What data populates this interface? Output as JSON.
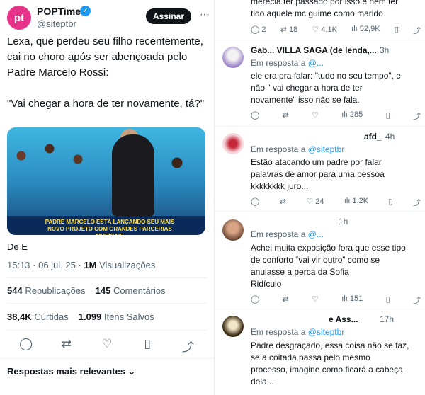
{
  "post": {
    "avatar_text": "pt",
    "name": "POPTime",
    "handle": "@siteptbr",
    "follow_label": "Assinar",
    "text": "Lexa, que perdeu seu filho recentemente, cai no choro após ser abençoada pelo Padre Marcelo Rossi:\n\n\"Vai chegar a hora de ter novamente, tá?\"",
    "media_ticker": "PADRE MARCELO ESTÁ LANÇANDO SEU MAIS NOVO PROJETO COM GRANDES PARCERIAS MUSICAIS",
    "from_label": "De E",
    "time": "15:13 · 06 jul. 25 · ",
    "views_count": "1M",
    "views_label": "Visualizações",
    "reposts_count": "544",
    "reposts_label": "Republicações",
    "comments_count": "145",
    "comments_label": "Comentários",
    "likes_count": "38,4K",
    "likes_label": "Curtidas",
    "saved_count": "1.099",
    "saved_label": "Itens Salvos",
    "relevant_label": "Respostas mais relevantes"
  },
  "replies": [
    {
      "text": "merecia ter passado por isso e nem ter\ntido aquele mc guime como marido",
      "replies": "2",
      "reposts": "18",
      "likes": "4,1K",
      "views": "52,9K"
    },
    {
      "name": "Gab... VILLA SAGA (de lenda,...",
      "time": "3h",
      "in_reply_label": "Em resposta a",
      "in_reply_handle": "@...",
      "text": "ele era pra falar: \"tudo no seu tempo\", e\nnão \" vai chegar a hora de ter\nnovamente\" isso não se fala.",
      "replies": "",
      "reposts": "",
      "likes": "",
      "views": "285"
    },
    {
      "name": "afd_",
      "time": "4h",
      "in_reply_label": "Em resposta a",
      "in_reply_handle": "@siteptbr",
      "text": "Estão atacando um padre por falar\npalavras de amor para uma pessoa\nkkkkkkkk juro...",
      "replies": "",
      "reposts": "",
      "likes": "24",
      "views": "1,2K"
    },
    {
      "name": "",
      "time": "1h",
      "in_reply_label": "Em resposta a",
      "in_reply_handle": "@...",
      "text": "Achei muita exposição fora que esse tipo\nde conforto “vai vir outro” como se\nanulasse a perca da Sofia\nRidículo",
      "replies": "",
      "reposts": "",
      "likes": "",
      "views": "151"
    },
    {
      "name": "e Ass...",
      "time": "17h",
      "in_reply_label": "Em resposta a",
      "in_reply_handle": "@siteptbr",
      "text": "Padre desgraçado, essa coisa não se faz,\nse a coitada passa pelo mesmo\nprocesso, imagine como ficará a cabeça\ndela..."
    }
  ],
  "icons": {
    "reply": "💬",
    "repost": "🔁",
    "like": "♡",
    "views": "📊",
    "bookmark": "🔖",
    "share": "⤴"
  }
}
